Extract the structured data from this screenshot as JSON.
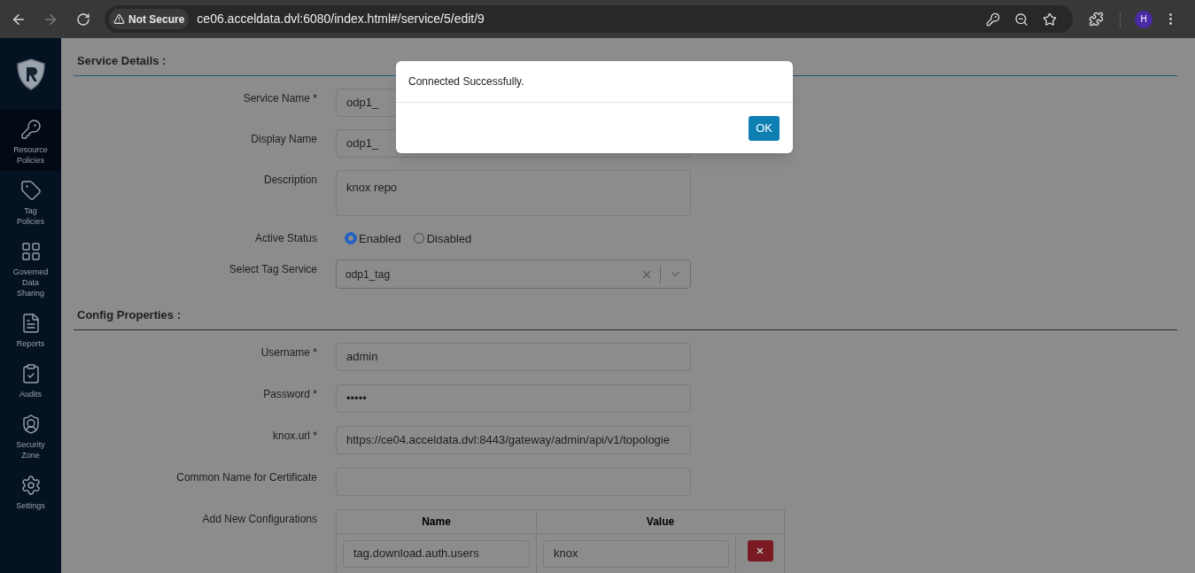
{
  "browser": {
    "security": "Not Secure",
    "url": "ce06.acceldata.dvl:6080/index.html#/service/5/edit/9",
    "profile": "H"
  },
  "sidebar": {
    "items": [
      {
        "kind": "key",
        "label": "Resource Policies",
        "selected": true
      },
      {
        "kind": "tag",
        "label": "Tag Policies",
        "selected": false
      },
      {
        "kind": "grid",
        "label": "Governed Data Sharing",
        "selected": false
      },
      {
        "kind": "report",
        "label": "Reports",
        "selected": false
      },
      {
        "kind": "audit",
        "label": "Audits",
        "selected": false
      },
      {
        "kind": "shield",
        "label": "Security Zone",
        "selected": false
      },
      {
        "kind": "gear",
        "label": "Settings",
        "selected": false
      }
    ]
  },
  "service_details": {
    "heading": "Service Details :",
    "fields": [
      {
        "kind": "text",
        "label": "Service Name *",
        "value": "odp1_"
      },
      {
        "kind": "text",
        "label": "Display Name",
        "value": "odp1_"
      },
      {
        "kind": "textarea",
        "label": "Description",
        "value": "knox repo"
      },
      {
        "kind": "radio",
        "label": "Active Status",
        "options": [
          {
            "label": "Enabled",
            "selected": true
          },
          {
            "label": "Disabled",
            "selected": false
          }
        ]
      },
      {
        "kind": "select",
        "label": "Select Tag Service",
        "value": "odp1_tag"
      }
    ]
  },
  "config_properties": {
    "heading": "Config Properties :",
    "fields": [
      {
        "kind": "text",
        "label": "Username *",
        "value": "admin"
      },
      {
        "kind": "text",
        "label": "Password *",
        "value": "•••••"
      },
      {
        "kind": "text",
        "label": "knox.url *",
        "value": "https://ce04.acceldata.dvl:8443/gateway/admin/api/v1/topologie"
      },
      {
        "kind": "text",
        "label": "Common Name for Certificate"
      }
    ],
    "configurations": {
      "label": "Add New Configurations",
      "columns": [
        "Name",
        "Value"
      ],
      "rows": [
        {
          "name": "tag.download.auth.users",
          "value": "knox"
        }
      ]
    }
  },
  "dialog": {
    "message": "Connected Successfully.",
    "button": "OK"
  }
}
